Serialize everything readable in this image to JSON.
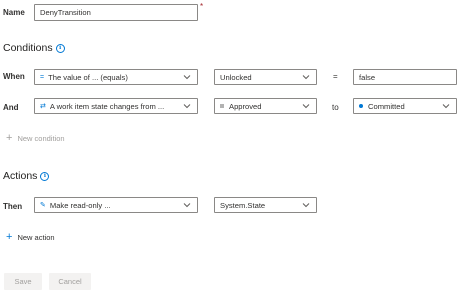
{
  "name": {
    "label": "Name",
    "value": "DenyTransition",
    "required_marker": "*"
  },
  "conditions": {
    "title": "Conditions",
    "info_icon": "info-icon",
    "rows": [
      {
        "prefix": "When",
        "condition": "The value of ... (equals)",
        "condition_icon": "equals-icon",
        "field": "Unlocked",
        "operator": "=",
        "value": "false"
      },
      {
        "prefix": "And",
        "condition": "A work item state changes from ...",
        "condition_icon": "state-transition-icon",
        "from_state": "Approved",
        "from_state_color": "#b2b2b2",
        "to_label": "to",
        "to_state": "Committed",
        "to_state_color": "#0078d4"
      }
    ],
    "add_label": "New condition"
  },
  "actions": {
    "title": "Actions",
    "info_icon": "info-icon",
    "rows": [
      {
        "prefix": "Then",
        "action": "Make read-only ...",
        "action_icon": "read-only-icon",
        "field": "System.State"
      }
    ],
    "add_label": "New action"
  },
  "footer": {
    "save_label": "Save",
    "cancel_label": "Cancel"
  },
  "colors": {
    "accent": "#0078d4",
    "required": "#a4262c",
    "disabled_text": "#a19f9d"
  }
}
